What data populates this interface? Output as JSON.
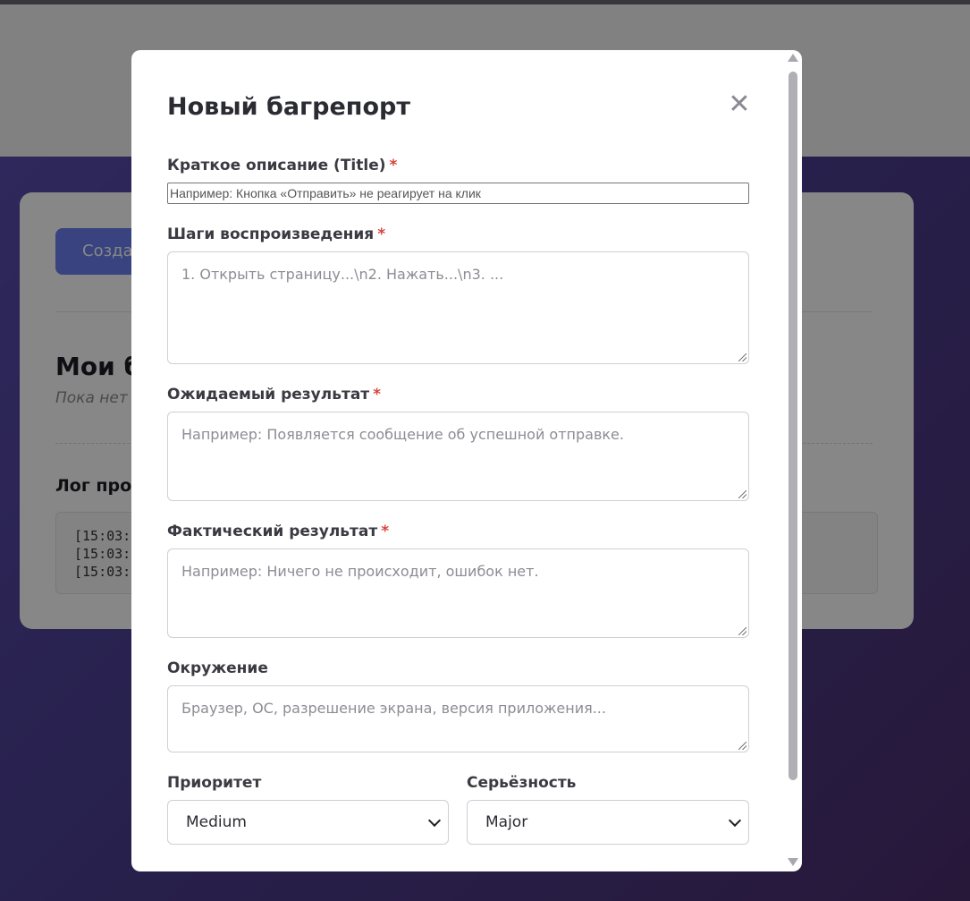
{
  "background_page": {
    "create_button_label": "Создать",
    "my_reports_title": "Мои багрепорты",
    "my_reports_empty": "Пока нет багрепортов",
    "log_title": "Лог происходящего",
    "log_lines": [
      "[15:03:",
      "[15:03:",
      "[15:03:"
    ]
  },
  "modal": {
    "title": "Новый багрепорт",
    "close_symbol": "✕",
    "required_mark": "*",
    "fields": {
      "title": {
        "label": "Краткое описание (Title)",
        "placeholder": "Например: Кнопка «Отправить» не реагирует на клик"
      },
      "steps": {
        "label": "Шаги воспроизведения",
        "placeholder": "1. Открыть страницу...\\n2. Нажать...\\n3. ..."
      },
      "expected": {
        "label": "Ожидаемый результат",
        "placeholder": "Например: Появляется сообщение об успешной отправке."
      },
      "actual": {
        "label": "Фактический результат",
        "placeholder": "Например: Ничего не происходит, ошибок нет."
      },
      "environment": {
        "label": "Окружение",
        "placeholder": "Браузер, ОС, разрешение экрана, версия приложения..."
      },
      "priority": {
        "label": "Приоритет",
        "value": "Medium"
      },
      "severity": {
        "label": "Серьёзность",
        "value": "Major"
      }
    }
  },
  "colors": {
    "accent": "#6b7ff0",
    "required": "#d9443b",
    "overlay": "rgba(0,0,0,0.47)"
  },
  "icons": {
    "close": "close-icon",
    "select_chevron": "chevron-down-icon"
  }
}
